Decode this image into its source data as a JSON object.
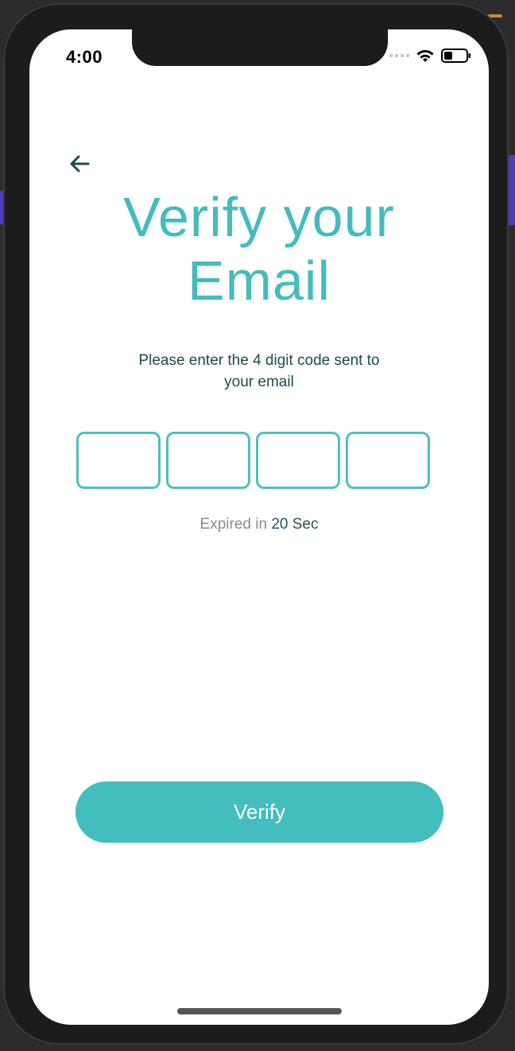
{
  "status_bar": {
    "time": "4:00"
  },
  "header": {
    "back_icon": "arrow-left-icon"
  },
  "title": {
    "line1": "Verify your",
    "line2": "Email"
  },
  "subtitle": {
    "line1": "Please enter the 4 digit code sent to",
    "line2": "your email"
  },
  "code_inputs": [
    {
      "value": "",
      "placeholder": ""
    },
    {
      "value": "",
      "placeholder": ""
    },
    {
      "value": "",
      "placeholder": ""
    },
    {
      "value": "",
      "placeholder": ""
    }
  ],
  "timer": {
    "label": "Expired in",
    "value": "20 Sec"
  },
  "verify_button": {
    "label": "Verify"
  },
  "colors": {
    "accent": "#45bcbc",
    "text_dark": "#1e4a4e",
    "muted": "#8a8a8a",
    "button": "#43bdbd"
  }
}
